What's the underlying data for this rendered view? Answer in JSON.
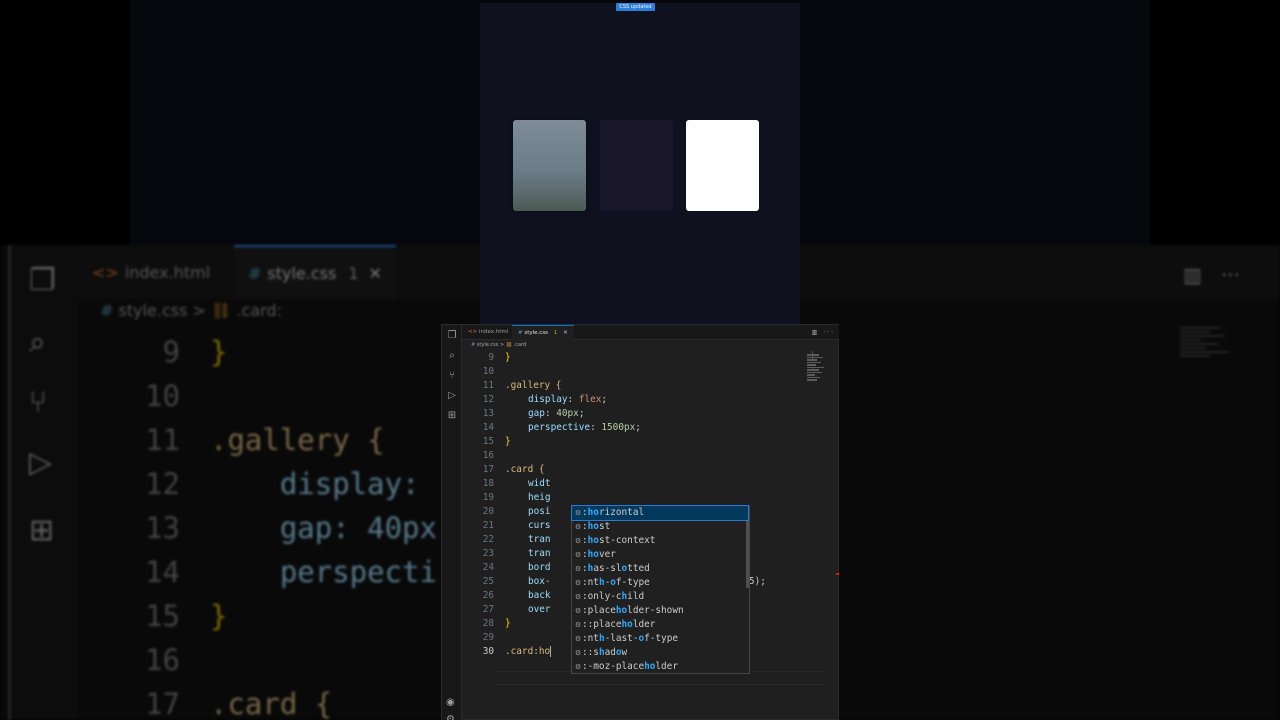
{
  "preview": {
    "toast": "CSS updated"
  },
  "background_editor": {
    "tabs": [
      {
        "icon": "<>",
        "label": "index.html"
      },
      {
        "icon": "#",
        "label": "style.css",
        "badge": "1",
        "close": "✕"
      }
    ],
    "breadcrumb": {
      "file": "style.css",
      "sep": ">",
      "symbol": ".card:"
    },
    "lines": [
      {
        "n": "9",
        "code": "}"
      },
      {
        "n": "10",
        "code": ""
      },
      {
        "n": "11",
        "code": ".gallery {"
      },
      {
        "n": "12",
        "code": "    display:"
      },
      {
        "n": "13",
        "code": "    gap: 40px"
      },
      {
        "n": "14",
        "code": "    perspecti"
      },
      {
        "n": "15",
        "code": "}"
      },
      {
        "n": "16",
        "code": ""
      },
      {
        "n": "17",
        "code": ".card {"
      }
    ]
  },
  "editor": {
    "tabs": [
      {
        "icon": "<>",
        "label": "index.html"
      },
      {
        "icon": "#",
        "label": "style.css",
        "badge": "1",
        "close": "✕"
      }
    ],
    "toolbar": {
      "split": "▥",
      "more": "···"
    },
    "breadcrumb": {
      "file": "style.css",
      "sep": ">",
      "symbol": ".card"
    },
    "lines": [
      {
        "n": "9",
        "text": "}"
      },
      {
        "n": "10",
        "text": ""
      },
      {
        "n": "11",
        "text": ".gallery {"
      },
      {
        "n": "12",
        "prop": "display",
        "value": "flex"
      },
      {
        "n": "13",
        "prop": "gap",
        "value": "40px"
      },
      {
        "n": "14",
        "prop": "perspective",
        "value": "1500px"
      },
      {
        "n": "15",
        "text": "}"
      },
      {
        "n": "16",
        "text": ""
      },
      {
        "n": "17",
        "text": ".card {"
      },
      {
        "n": "18",
        "partial": "widt"
      },
      {
        "n": "19",
        "partial": "heig"
      },
      {
        "n": "20",
        "partial": "posi"
      },
      {
        "n": "21",
        "partial": "curs"
      },
      {
        "n": "22",
        "partial": "tran"
      },
      {
        "n": "23",
        "partial": "tran"
      },
      {
        "n": "24",
        "partial": "bord"
      },
      {
        "n": "25",
        "partial": "box-",
        "tail": ",0.5);"
      },
      {
        "n": "26",
        "partial": "back"
      },
      {
        "n": "27",
        "partial": "over"
      },
      {
        "n": "28",
        "text": "}"
      },
      {
        "n": "29",
        "text": ""
      },
      {
        "n": "30",
        "text": ".card:ho"
      }
    ],
    "suggestions": [
      {
        "pre": ":",
        "hl": "ho",
        "post": "rizontal"
      },
      {
        "pre": ":",
        "hl": "ho",
        "post": "st"
      },
      {
        "pre": ":",
        "hl": "ho",
        "post": "st-context"
      },
      {
        "pre": ":",
        "hl": "ho",
        "post": "ver"
      },
      {
        "pre": ":",
        "hl": "h",
        "post": "as-sl",
        "hl2": "o",
        "post2": "tted"
      },
      {
        "pre": ":nt",
        "hl": "h",
        "post": "-",
        "hl2": "o",
        "post2": "f-type"
      },
      {
        "pre": ":only-c",
        "hl": "h",
        "post": "ild"
      },
      {
        "pre": ":place",
        "hl": "ho",
        "post": "lder-shown"
      },
      {
        "pre": "::place",
        "hl": "ho",
        "post": "lder"
      },
      {
        "pre": ":nt",
        "hl": "h",
        "post": "-last-",
        "hl2": "o",
        "post2": "f-type"
      },
      {
        "pre": "::s",
        "hl": "h",
        "post": "ad",
        "hl2": "o",
        "post2": "w"
      },
      {
        "pre": ":-moz-place",
        "hl": "ho",
        "post": "lder"
      }
    ]
  }
}
